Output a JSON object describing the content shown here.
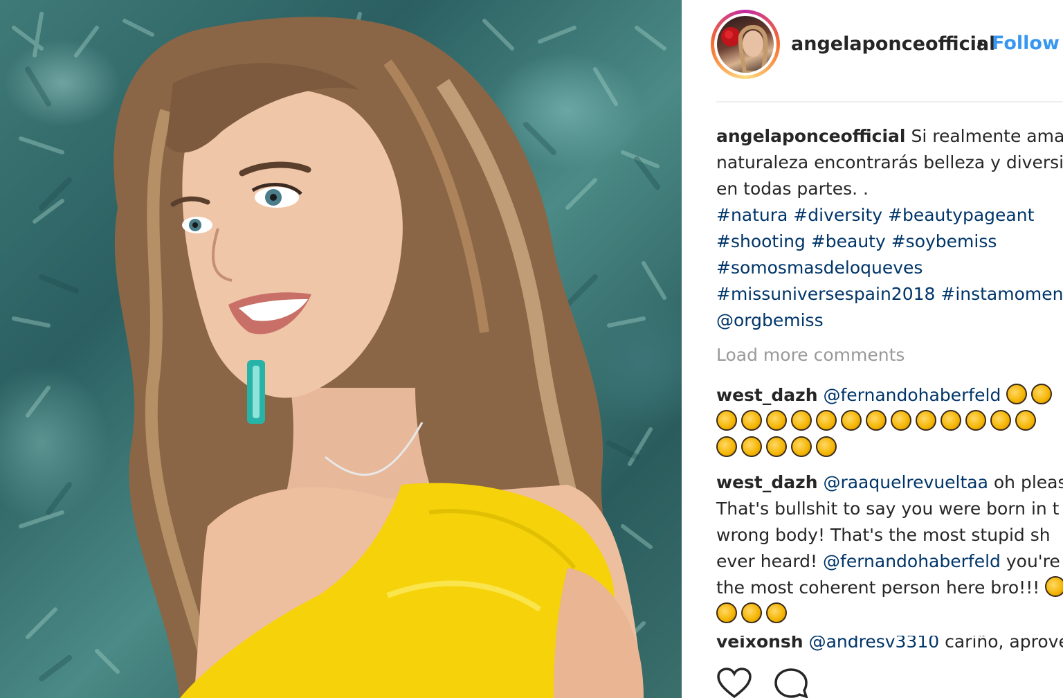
{
  "post": {
    "author": "angelaponceofficial",
    "separator": "•",
    "follow_label": "Follow"
  },
  "caption": {
    "username": "angelaponceofficial",
    "line1": "Si realmente amas",
    "line2": "naturaleza encontrarás belleza y diversi",
    "line3": "en todas partes. .",
    "line4": "#natura #diversity #beautypageant",
    "line5": "#shooting #beauty #soybemiss",
    "line6": "#somosmasdeloqueves",
    "line7": "#missuniversespain2018 #instamomen",
    "line8": "@orgbemiss"
  },
  "load_more": "Load more comments",
  "comments": [
    {
      "username": "west_dazh",
      "mention": "@fernandohaberfeld",
      "emoji_name": "clapping-hands-icon",
      "emoji_rows": [
        2,
        13,
        5
      ]
    },
    {
      "username": "west_dazh",
      "line1_mention": "@raaquelrevueltaa",
      "line1_text": "oh pleas",
      "line2": "That's bullshit to say you were born in t",
      "line3": "wrong body! That's the most stupid sh",
      "line4_text": "ever heard!",
      "line4_mention": "@fernandohaberfeld",
      "line4_tail": "you're",
      "line5": "the most coherent person here bro!!!",
      "emoji_rows": [
        1,
        3
      ]
    },
    {
      "username": "veixonsh",
      "mention": "@andresv3310",
      "text": "cariño, aprove"
    }
  ],
  "actions": {
    "like_icon": "heart-icon",
    "comment_icon": "comment-icon"
  },
  "colors": {
    "link": "#3897f0",
    "hashtag": "#003569",
    "muted": "#999999",
    "dress": "#f5d20a"
  }
}
